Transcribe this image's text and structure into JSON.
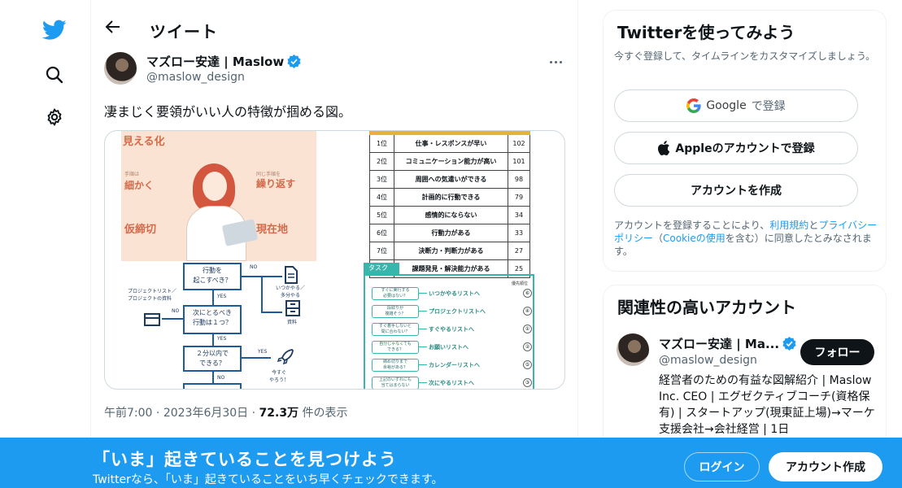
{
  "colors": {
    "brand": "#1d9bf0",
    "text": "#0f1419",
    "secondary": "#536471",
    "verified": "#1d9bf0"
  },
  "nav": {
    "icons": [
      "twitter-logo-icon",
      "search-icon",
      "gear-icon"
    ]
  },
  "header": {
    "title": "ツイート"
  },
  "tweet": {
    "author_name": "マズロー安達 | Maslow",
    "author_handle": "@maslow_design",
    "text": "凄まじく要領がいい人の特徴が掴める図。",
    "time": "午前7:00",
    "date": "2023年6月30日",
    "views_count": "72.3万",
    "views_label": "件の表示",
    "sep": "·"
  },
  "media": {
    "illust_labels": [
      "見える化",
      "細かく",
      "繰り返す",
      "仮締切",
      "現在地",
      "手順は",
      "同じ手順を"
    ],
    "ranking": [
      {
        "rank": "1位",
        "item": "仕事・レスポンスが早い",
        "count": "102"
      },
      {
        "rank": "2位",
        "item": "コミュニケーション能力が高い",
        "count": "101"
      },
      {
        "rank": "3位",
        "item": "周囲への気遣いができる",
        "count": "98"
      },
      {
        "rank": "4位",
        "item": "計画的に行動できる",
        "count": "79"
      },
      {
        "rank": "5位",
        "item": "感情的にならない",
        "count": "34"
      },
      {
        "rank": "6位",
        "item": "行動力がある",
        "count": "33"
      },
      {
        "rank": "7位",
        "item": "決断力・判断力がある",
        "count": "27"
      },
      {
        "rank": "8位",
        "item": "課題発見・解決能力がある",
        "count": "25"
      }
    ],
    "flow": {
      "box1": "行動を\n起こすべき？",
      "box2": "次にとるべき\n行動は１つ？",
      "box3": "２分以内で\nできる？",
      "no": "NO",
      "yes": "YES",
      "side1": "いつかやる／\n多分やる",
      "side2": "資料",
      "side3": "プロジェクトリスト／\nプロジェクトの資料",
      "side4": "今すぐ\nやろう！"
    },
    "task": {
      "header": "タスク",
      "priority": "優先順位",
      "items": [
        {
          "q": "すぐに実行する\n必要はない？",
          "a": "いつかやるリストへ",
          "n": "⑥"
        },
        {
          "q": "段取りが\n複雑そう？",
          "a": "プロジェクトリストへ",
          "n": "④"
        },
        {
          "q": "すぐ着手しないと\n間に合わない？",
          "a": "すぐやるリストへ",
          "n": "①"
        },
        {
          "q": "自分じゃなくても\nできる？",
          "a": "お願いリストへ",
          "n": "②"
        },
        {
          "q": "締め切りまで\n余裕がある？",
          "a": "カレンダーリストへ",
          "n": "⑤"
        },
        {
          "q": "上記のいずれにも\n当てはまらない",
          "a": "次にやるリストへ",
          "n": "③"
        }
      ]
    }
  },
  "signup": {
    "title": "Twitterを使ってみよう",
    "subtitle": "今すぐ登録して、タイムラインをカスタマイズしましょう。",
    "google_label": "Google",
    "google_suffix": "で登録",
    "apple_label": "Appleのアカウントで登録",
    "create_label": "アカウントを作成",
    "legal_1": "アカウントを登録することにより、",
    "legal_terms": "利用規約",
    "legal_and": "と",
    "legal_privacy": "プライバシーポリシー",
    "legal_paren_open": "（",
    "legal_cookie": "Cookieの使用",
    "legal_2": "を含む）に同意したとみなされます。"
  },
  "related": {
    "title": "関連性の高いアカウント",
    "name": "マズロー安達 | Ma...",
    "handle": "@maslow_design",
    "follow_label": "フォロー",
    "bio": "経営者のための有益な図解紹介 | Maslow Inc. CEO | エグゼクティブコーチ(資格保有) | スタートアップ(現東証上場)→マーケ支援会社→会社経営 | 1日"
  },
  "banner": {
    "headline": "「いま」起きていることを見つけよう",
    "sub": "Twitterなら、「いま」起きていることをいち早くチェックできます。",
    "login_label": "ログイン",
    "create_label": "アカウント作成"
  }
}
